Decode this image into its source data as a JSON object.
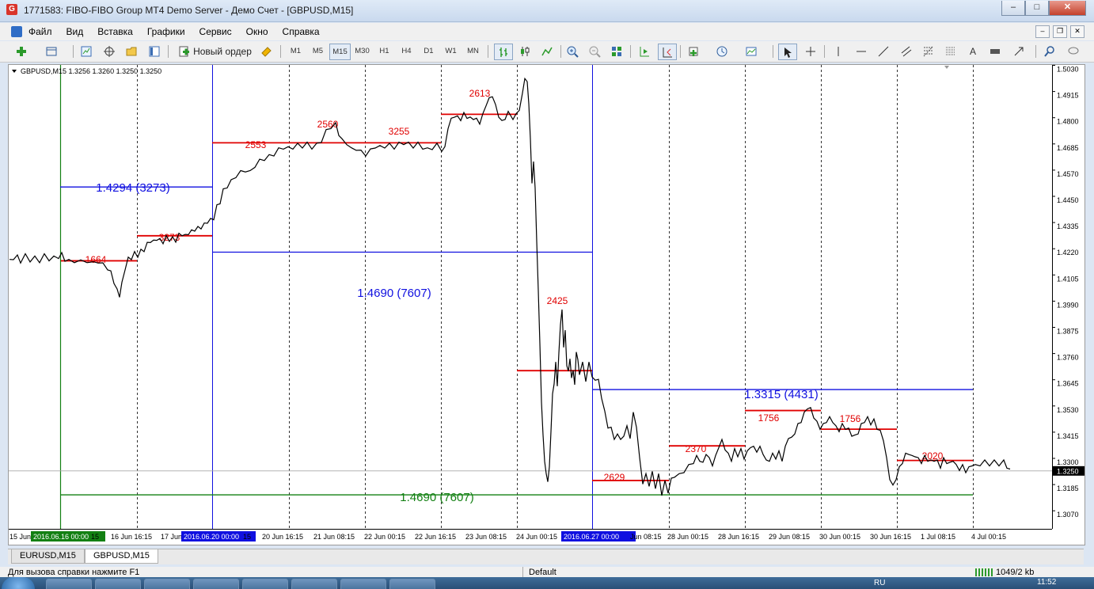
{
  "window": {
    "title": "1771583: FIBO-FIBO Group MT4 Demo Server - Демо Счет - [GBPUSD,M15]",
    "app_icon": "G",
    "minimize": "–",
    "restore": "□",
    "close": "✕"
  },
  "menu": [
    "Файл",
    "Вид",
    "Вставка",
    "Графики",
    "Сервис",
    "Окно",
    "Справка"
  ],
  "mdi_buttons": [
    "–",
    "❐",
    "✕"
  ],
  "toolbar": {
    "new_order": "Новый ордер",
    "timeframes": [
      "M1",
      "M5",
      "M15",
      "M30",
      "H1",
      "H4",
      "D1",
      "W1",
      "MN"
    ],
    "selected_timeframe": "M15"
  },
  "chart": {
    "header": "GBPUSD,M15  1.3256 1.3260 1.3250 1.3250",
    "price_tag": "1.3250",
    "colors": {
      "red": "#e00000",
      "blue": "#1010e0",
      "green": "#138013",
      "price": "#000000"
    }
  },
  "chart_data": {
    "type": "line",
    "symbol": "GBPUSD",
    "timeframe": "M15",
    "ylim": [
      1.307,
      1.503
    ],
    "y_ticks": [
      "1.5030",
      "1.4915",
      "1.4800",
      "1.4685",
      "1.4570",
      "1.4450",
      "1.4335",
      "1.4220",
      "1.4105",
      "1.3990",
      "1.3875",
      "1.3760",
      "1.3645",
      "1.3530",
      "1.3415",
      "1.3300",
      "1.3185",
      "1.3070"
    ],
    "x_ticks": [
      "15 Jun",
      "2016.06.16 00:00",
      "16 Jun 16:15",
      "17 Jun",
      "2016.06.20 00:00",
      "20 Jun 16:15",
      "21 Jun 08:15",
      "22 Jun 00:15",
      "22 Jun 16:15",
      "23 Jun 08:15",
      "24 Jun 00:15",
      "2016.06.27 00:00",
      "Jun 08:15",
      "28 Jun 00:15",
      "28 Jun 16:15",
      "29 Jun 08:15",
      "30 Jun 00:15",
      "30 Jun 16:15",
      "1 Jul 08:15",
      "4 Jul 00:15"
    ],
    "x_tick_fragments": [
      "15",
      "15"
    ],
    "close_points": [
      [
        0,
        1.417
      ],
      [
        5,
        1.4185
      ],
      [
        10,
        1.419
      ],
      [
        14,
        1.417
      ],
      [
        20,
        1.4195
      ],
      [
        26,
        1.4175
      ],
      [
        32,
        1.4185
      ],
      [
        38,
        1.4172
      ],
      [
        44,
        1.4195
      ],
      [
        50,
        1.418
      ],
      [
        56,
        1.4185
      ],
      [
        62,
        1.419
      ],
      [
        66,
        1.42
      ],
      [
        70,
        1.4178
      ],
      [
        75,
        1.417
      ],
      [
        82,
        1.4172
      ],
      [
        90,
        1.4168
      ],
      [
        98,
        1.4172
      ],
      [
        106,
        1.416
      ],
      [
        112,
        1.417
      ],
      [
        118,
        1.4155
      ],
      [
        124,
        1.414
      ],
      [
        128,
        1.412
      ],
      [
        132,
        1.408
      ],
      [
        136,
        1.404
      ],
      [
        139,
        1.402
      ],
      [
        142,
        1.407
      ],
      [
        146,
        1.414
      ],
      [
        150,
        1.418
      ],
      [
        154,
        1.4185
      ],
      [
        158,
        1.4205
      ],
      [
        162,
        1.4195
      ],
      [
        166,
        1.4215
      ],
      [
        170,
        1.422
      ],
      [
        174,
        1.4245
      ],
      [
        178,
        1.426
      ],
      [
        182,
        1.4255
      ],
      [
        186,
        1.427
      ],
      [
        190,
        1.4262
      ],
      [
        194,
        1.4255
      ],
      [
        198,
        1.4275
      ],
      [
        202,
        1.4265
      ],
      [
        206,
        1.427
      ],
      [
        210,
        1.4262
      ],
      [
        214,
        1.4285
      ],
      [
        218,
        1.429
      ],
      [
        222,
        1.428
      ],
      [
        226,
        1.4295
      ],
      [
        230,
        1.43
      ],
      [
        234,
        1.431
      ],
      [
        238,
        1.4315
      ],
      [
        242,
        1.432
      ],
      [
        246,
        1.433
      ],
      [
        250,
        1.4345
      ],
      [
        254,
        1.435
      ],
      [
        258,
        1.436
      ],
      [
        262,
        1.441
      ],
      [
        266,
        1.443
      ],
      [
        270,
        1.448
      ],
      [
        275,
        1.45
      ],
      [
        280,
        1.452
      ],
      [
        286,
        1.4545
      ],
      [
        292,
        1.456
      ],
      [
        298,
        1.457
      ],
      [
        304,
        1.456
      ],
      [
        310,
        1.459
      ],
      [
        316,
        1.461
      ],
      [
        322,
        1.462
      ],
      [
        328,
        1.463
      ],
      [
        334,
        1.464
      ],
      [
        340,
        1.466
      ],
      [
        346,
        1.467
      ],
      [
        352,
        1.4665
      ],
      [
        358,
        1.467
      ],
      [
        364,
        1.468
      ],
      [
        370,
        1.4675
      ],
      [
        376,
        1.4685
      ],
      [
        382,
        1.467
      ],
      [
        388,
        1.468
      ],
      [
        394,
        1.47
      ],
      [
        400,
        1.474
      ],
      [
        406,
        1.476
      ],
      [
        412,
        1.477
      ],
      [
        416,
        1.473
      ],
      [
        420,
        1.47
      ],
      [
        426,
        1.469
      ],
      [
        432,
        1.466
      ],
      [
        438,
        1.4665
      ],
      [
        444,
        1.465
      ],
      [
        450,
        1.464
      ],
      [
        456,
        1.4655
      ],
      [
        462,
        1.4675
      ],
      [
        468,
        1.467
      ],
      [
        474,
        1.4675
      ],
      [
        480,
        1.468
      ],
      [
        486,
        1.467
      ],
      [
        492,
        1.4685
      ],
      [
        498,
        1.469
      ],
      [
        504,
        1.4685
      ],
      [
        510,
        1.4675
      ],
      [
        516,
        1.4685
      ],
      [
        522,
        1.467
      ],
      [
        528,
        1.466
      ],
      [
        534,
        1.4668
      ],
      [
        540,
        1.468
      ],
      [
        546,
        1.466
      ],
      [
        550,
        1.4665
      ],
      [
        554,
        1.476
      ],
      [
        558,
        1.479
      ],
      [
        562,
        1.481
      ],
      [
        566,
        1.48
      ],
      [
        570,
        1.4795
      ],
      [
        574,
        1.4815
      ],
      [
        578,
        1.4805
      ],
      [
        582,
        1.4795
      ],
      [
        586,
        1.48
      ],
      [
        590,
        1.479
      ],
      [
        594,
        1.478
      ],
      [
        598,
        1.481
      ],
      [
        602,
        1.486
      ],
      [
        606,
        1.488
      ],
      [
        610,
        1.49
      ],
      [
        614,
        1.485
      ],
      [
        618,
        1.481
      ],
      [
        622,
        1.478
      ],
      [
        626,
        1.48
      ],
      [
        630,
        1.482
      ],
      [
        636,
        1.48
      ],
      [
        640,
        1.481
      ],
      [
        644,
        1.484
      ],
      [
        648,
        1.49
      ],
      [
        651,
        1.498
      ],
      [
        654,
        1.495
      ],
      [
        656,
        1.487
      ],
      [
        658,
        1.47
      ],
      [
        660,
        1.452
      ],
      [
        662,
        1.46
      ],
      [
        664,
        1.45
      ],
      [
        666,
        1.425
      ],
      [
        668,
        1.405
      ],
      [
        670,
        1.38
      ],
      [
        672,
        1.356
      ],
      [
        674,
        1.34
      ],
      [
        676,
        1.33
      ],
      [
        678,
        1.323
      ],
      [
        680,
        1.321
      ],
      [
        682,
        1.326
      ],
      [
        684,
        1.343
      ],
      [
        686,
        1.358
      ],
      [
        688,
        1.364
      ],
      [
        690,
        1.372
      ],
      [
        692,
        1.363
      ],
      [
        694,
        1.376
      ],
      [
        696,
        1.39
      ],
      [
        698,
        1.395
      ],
      [
        700,
        1.38
      ],
      [
        702,
        1.386
      ],
      [
        704,
        1.372
      ],
      [
        706,
        1.368
      ],
      [
        708,
        1.375
      ],
      [
        710,
        1.365
      ],
      [
        712,
        1.37
      ],
      [
        714,
        1.362
      ],
      [
        716,
        1.378
      ],
      [
        718,
        1.373
      ],
      [
        720,
        1.368
      ],
      [
        724,
        1.372
      ],
      [
        728,
        1.365
      ],
      [
        732,
        1.372
      ],
      [
        736,
        1.367
      ],
      [
        740,
        1.364
      ],
      [
        744,
        1.366
      ],
      [
        748,
        1.356
      ],
      [
        752,
        1.352
      ],
      [
        756,
        1.343
      ],
      [
        760,
        1.345
      ],
      [
        764,
        1.338
      ],
      [
        768,
        1.342
      ],
      [
        772,
        1.338
      ],
      [
        776,
        1.341
      ],
      [
        780,
        1.344
      ],
      [
        784,
        1.34
      ],
      [
        788,
        1.35
      ],
      [
        792,
        1.345
      ],
      [
        796,
        1.33
      ],
      [
        800,
        1.32
      ],
      [
        804,
        1.323
      ],
      [
        808,
        1.319
      ],
      [
        812,
        1.324
      ],
      [
        816,
        1.318
      ],
      [
        820,
        1.323
      ],
      [
        824,
        1.315
      ],
      [
        828,
        1.32
      ],
      [
        832,
        1.316
      ],
      [
        836,
        1.321
      ],
      [
        840,
        1.323
      ],
      [
        846,
        1.323
      ],
      [
        852,
        1.325
      ],
      [
        858,
        1.327
      ],
      [
        864,
        1.329
      ],
      [
        868,
        1.331
      ],
      [
        872,
        1.33
      ],
      [
        876,
        1.328
      ],
      [
        880,
        1.333
      ],
      [
        884,
        1.33
      ],
      [
        888,
        1.328
      ],
      [
        892,
        1.331
      ],
      [
        896,
        1.336
      ],
      [
        900,
        1.338
      ],
      [
        904,
        1.335
      ],
      [
        908,
        1.332
      ],
      [
        912,
        1.33
      ],
      [
        916,
        1.334
      ],
      [
        920,
        1.332
      ],
      [
        924,
        1.334
      ],
      [
        928,
        1.331
      ],
      [
        932,
        1.333
      ],
      [
        936,
        1.336
      ],
      [
        940,
        1.335
      ],
      [
        944,
        1.334
      ],
      [
        948,
        1.335
      ],
      [
        952,
        1.333
      ],
      [
        956,
        1.329
      ],
      [
        960,
        1.33
      ],
      [
        964,
        1.332
      ],
      [
        968,
        1.331
      ],
      [
        972,
        1.333
      ],
      [
        976,
        1.33
      ],
      [
        980,
        1.335
      ],
      [
        984,
        1.34
      ],
      [
        988,
        1.339
      ],
      [
        992,
        1.342
      ],
      [
        996,
        1.345
      ],
      [
        1000,
        1.347
      ],
      [
        1004,
        1.35
      ],
      [
        1008,
        1.353
      ],
      [
        1012,
        1.352
      ],
      [
        1016,
        1.349
      ],
      [
        1020,
        1.346
      ],
      [
        1024,
        1.344
      ],
      [
        1028,
        1.345
      ],
      [
        1032,
        1.347
      ],
      [
        1036,
        1.348
      ],
      [
        1040,
        1.347
      ],
      [
        1044,
        1.344
      ],
      [
        1048,
        1.343
      ],
      [
        1052,
        1.345
      ],
      [
        1056,
        1.344
      ],
      [
        1060,
        1.343
      ],
      [
        1064,
        1.341
      ],
      [
        1068,
        1.34
      ],
      [
        1072,
        1.342
      ],
      [
        1076,
        1.345
      ],
      [
        1080,
        1.347
      ],
      [
        1084,
        1.348
      ],
      [
        1088,
        1.346
      ],
      [
        1092,
        1.347
      ],
      [
        1096,
        1.344
      ],
      [
        1100,
        1.342
      ],
      [
        1104,
        1.339
      ],
      [
        1108,
        1.33
      ],
      [
        1112,
        1.322
      ],
      [
        1116,
        1.318
      ],
      [
        1120,
        1.322
      ],
      [
        1124,
        1.326
      ],
      [
        1128,
        1.329
      ],
      [
        1132,
        1.332
      ],
      [
        1136,
        1.333
      ],
      [
        1140,
        1.331
      ],
      [
        1144,
        1.332
      ],
      [
        1148,
        1.33
      ],
      [
        1152,
        1.329
      ],
      [
        1156,
        1.331
      ],
      [
        1160,
        1.33
      ],
      [
        1164,
        1.329
      ],
      [
        1168,
        1.33
      ],
      [
        1172,
        1.329
      ],
      [
        1176,
        1.327
      ],
      [
        1180,
        1.33
      ],
      [
        1184,
        1.329
      ],
      [
        1188,
        1.328
      ],
      [
        1192,
        1.33
      ],
      [
        1196,
        1.327
      ],
      [
        1200,
        1.326
      ],
      [
        1204,
        1.327
      ],
      [
        1208,
        1.325
      ],
      [
        1212,
        1.326
      ],
      [
        1216,
        1.328
      ],
      [
        1220,
        1.327
      ],
      [
        1226,
        1.328
      ],
      [
        1232,
        1.329
      ],
      [
        1238,
        1.328
      ],
      [
        1244,
        1.329
      ],
      [
        1250,
        1.328
      ],
      [
        1256,
        1.329
      ],
      [
        1260,
        1.327
      ],
      [
        1264,
        1.325
      ]
    ],
    "horizontal_segments": [
      {
        "color": "red",
        "price": 1.4172,
        "label": "1664"
      },
      {
        "color": "red",
        "price": 1.4282,
        "label": "3273"
      },
      {
        "color": "red",
        "price": 1.469,
        "label": "2553"
      },
      {
        "color": "red",
        "price": 1.469,
        "label": "2560"
      },
      {
        "color": "red",
        "price": 1.469,
        "label": "3255"
      },
      {
        "color": "red",
        "price": 1.4815,
        "label": "2613"
      },
      {
        "color": "red",
        "price": 1.369,
        "label": "2425"
      },
      {
        "color": "red",
        "price": 1.3208,
        "label": "2629"
      },
      {
        "color": "red",
        "price": 1.336,
        "label": "2370"
      },
      {
        "color": "red",
        "price": 1.3515,
        "label": "1756"
      },
      {
        "color": "red",
        "price": 1.3433,
        "label": "1756"
      },
      {
        "color": "red",
        "price": 1.3296,
        "label": "2020"
      },
      {
        "color": "blue",
        "price": 1.4496,
        "label": "1.4294  (3273)"
      },
      {
        "color": "blue",
        "price": 1.421,
        "label": "1.4690  (7607)"
      },
      {
        "color": "blue",
        "price": 1.3607,
        "label": "1.3315   (4431)"
      },
      {
        "color": "green",
        "price": 1.3145,
        "label": "1.4690   (7607)"
      }
    ]
  },
  "tabs": [
    "EURUSD,M15",
    "GBPUSD,M15"
  ],
  "active_tab": "GBPUSD,M15",
  "status": {
    "help": "Для вызова справки нажмите F1",
    "profile": "Default",
    "traffic": "1049/2 kb"
  },
  "taskbar": {
    "lang": "RU",
    "time": "11:52"
  }
}
